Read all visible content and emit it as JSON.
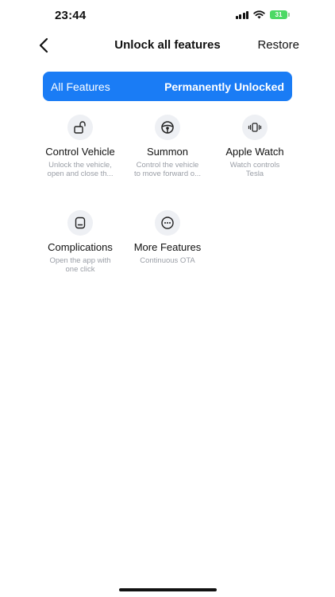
{
  "status": {
    "time": "23:44",
    "battery": "31"
  },
  "nav": {
    "title": "Unlock all features",
    "restore_label": "Restore"
  },
  "banner": {
    "left_label": "All Features",
    "right_label": "Permanently Unlocked"
  },
  "features": [
    {
      "icon": "unlock-icon",
      "title": "Control Vehicle",
      "desc_line1": "Unlock the vehicle,",
      "desc_line2": "open and close th..."
    },
    {
      "icon": "steering-wheel-icon",
      "title": "Summon",
      "desc_line1": "Control the vehicle",
      "desc_line2": "to move forward o..."
    },
    {
      "icon": "watch-vibrate-icon",
      "title": "Apple Watch",
      "desc_line1": "Watch controls",
      "desc_line2": "Tesla"
    },
    {
      "icon": "complication-icon",
      "title": "Complications",
      "desc_line1": "Open the app with",
      "desc_line2": "one click"
    },
    {
      "icon": "more-icon",
      "title": "More Features",
      "desc_line1": "Continuous OTA",
      "desc_line2": ""
    }
  ],
  "colors": {
    "accent": "#1a7cf5",
    "battery": "#4cd964",
    "icon_bg": "#eef0f4",
    "desc_text": "#9a9ea6"
  }
}
